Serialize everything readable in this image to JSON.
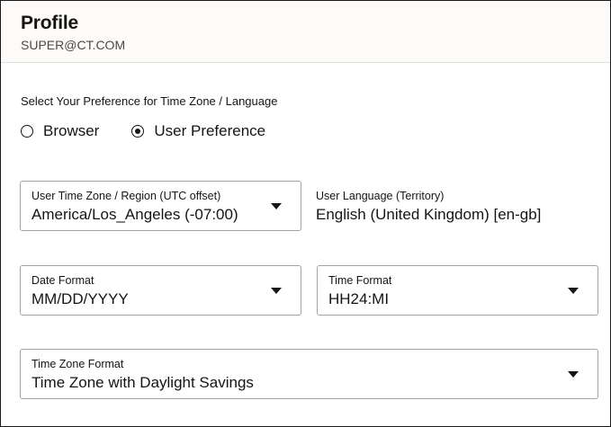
{
  "header": {
    "title": "Profile",
    "user": "SUPER@CT.COM"
  },
  "preference": {
    "section_label": "Select Your Preference for Time Zone / Language",
    "options": [
      {
        "label": "Browser",
        "selected": false
      },
      {
        "label": "User Preference",
        "selected": true
      }
    ]
  },
  "fields": {
    "time_zone": {
      "label": "User Time Zone / Region (UTC offset)",
      "value": "America/Los_Angeles (-07:00)"
    },
    "language": {
      "label": "User Language (Territory)",
      "value": "English (United Kingdom) [en-gb]"
    },
    "date_format": {
      "label": "Date Format",
      "value": "MM/DD/YYYY"
    },
    "time_format": {
      "label": "Time Format",
      "value": "HH24:MI"
    },
    "tz_format": {
      "label": "Time Zone Format",
      "value": "Time Zone with Daylight Savings"
    }
  },
  "icons": {
    "dropdown": "caret-down-icon",
    "radio": "radio-button-icon"
  },
  "colors": {
    "text": "#161513",
    "border": "#a6a39f",
    "header_bg": "#fcfbfa"
  }
}
